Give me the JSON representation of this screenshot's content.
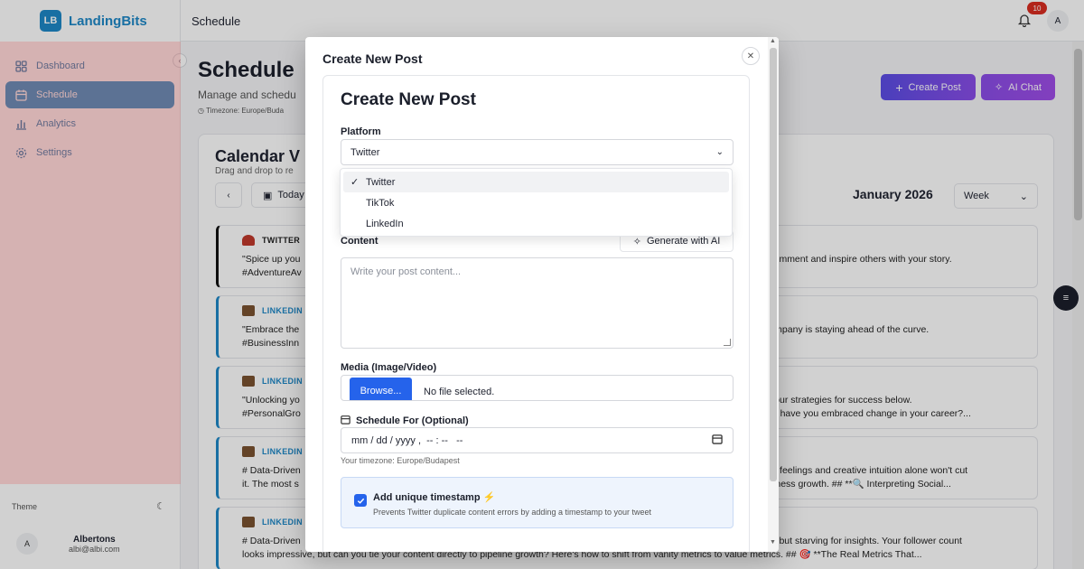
{
  "app": {
    "logo_badge": "LB",
    "name": "LandingBits",
    "section_title": "Schedule"
  },
  "sidebar": {
    "items": [
      {
        "label": "Dashboard",
        "icon": "dashboard-icon",
        "active": false
      },
      {
        "label": "Schedule",
        "icon": "calendar-icon",
        "active": true
      },
      {
        "label": "Analytics",
        "icon": "analytics-icon",
        "active": false
      },
      {
        "label": "Settings",
        "icon": "gear-icon",
        "active": false
      }
    ],
    "theme_label": "Theme",
    "user": {
      "avatar": "A",
      "name": "Albertons",
      "email": "albi@albi.com"
    }
  },
  "topbar": {
    "notification_count": "10",
    "avatar": "A"
  },
  "page": {
    "title": "Schedule",
    "subtitle": "Manage and schedu",
    "timezone": "Timezone: Europe/Buda",
    "create_post_label": "Create Post",
    "ai_chat_label": "AI Chat"
  },
  "calendar": {
    "title": "Calendar V",
    "subtitle": "Drag and drop to re",
    "today_label": "Today",
    "month": "January 2026",
    "view": "Week",
    "posts": [
      {
        "platform": "TWITTER",
        "type": "tw",
        "left1": "\"Spice up you",
        "left2": "#AdventureAv",
        "right1": "op a comment and inspire others with your story.",
        "right2": ""
      },
      {
        "platform": "LINKEDIN",
        "type": "li",
        "left1": "\"Embrace the",
        "left2": "#BusinessInn",
        "right1": "our company is staying ahead of the curve.",
        "right2": ""
      },
      {
        "platform": "LINKEDIN",
        "type": "li",
        "left1": "\"Unlocking yo",
        "left2": "#PersonalGro",
        "right1": "hare your strategies for success below.",
        "right2": "n. How have you embraced change in your career?..."
      },
      {
        "platform": "LINKEDIN",
        "type": "li",
        "full1": "# Data-Driven",
        "full2": "it. The most s",
        "right1": "pe, gut feelings and creative intuition alone won't cut",
        "right2": "ul business growth. ## **🔍 Interpreting Social..."
      },
      {
        "platform": "LINKEDIN",
        "type": "li",
        "full1": "# Data-Driven",
        "full2": "looks impressive, but can you tie your content directly to pipeline growth? Here's how to shift from vanity metrics to value metrics. ## 🎯 **The Real Metrics That...",
        "right1": "in data but starving for insights. Your follower count",
        "right2": ""
      }
    ]
  },
  "modal": {
    "title": "Create New Post",
    "form_title": "Create New Post",
    "platform_label": "Platform",
    "platform_value": "Twitter",
    "platform_options": [
      "Twitter",
      "TikTok",
      "LinkedIn"
    ],
    "content_label": "Content",
    "generate_label": "Generate with AI",
    "content_placeholder": "Write your post content...",
    "media_label": "Media (Image/Video)",
    "browse_label": "Browse...",
    "file_status": "No file selected.",
    "schedule_label": "Schedule For (Optional)",
    "date_placeholder": "mm / dd / yyyy ,  -- : --   --",
    "timezone_hint": "Your timezone: Europe/Budapest",
    "timestamp_title": "Add unique timestamp ⚡",
    "timestamp_desc": "Prevents Twitter duplicate content errors by adding a timestamp to your tweet",
    "timestamp_checked": true
  },
  "colors": {
    "accent": "#1e88c7",
    "primary_button": "#2563eb",
    "create_gradient_start": "#5b4de6",
    "ai_gradient_end": "#a04de8"
  }
}
